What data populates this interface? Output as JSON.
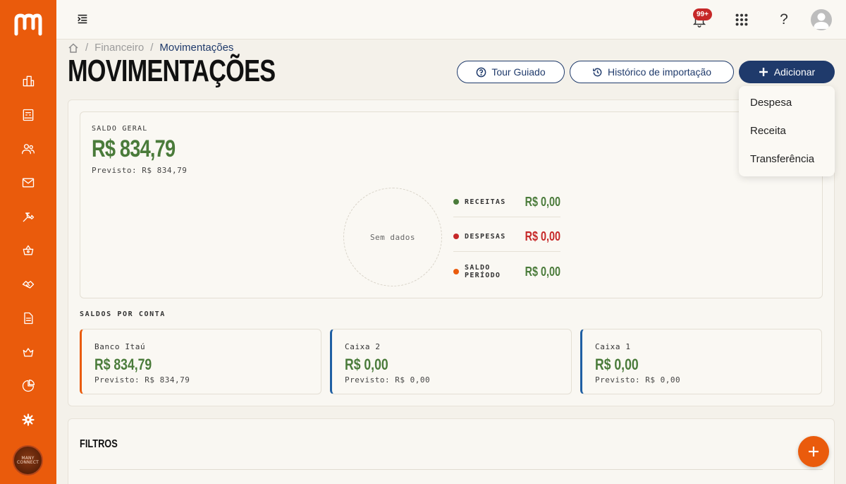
{
  "app": {
    "logo_icon": "m-logo-icon",
    "accent": "#ea5b0c",
    "primary": "#1f3a6b"
  },
  "sidebar": {
    "items": [
      {
        "icon": "building-icon"
      },
      {
        "icon": "cash-register-icon"
      },
      {
        "icon": "users-icon"
      },
      {
        "icon": "mail-icon"
      },
      {
        "icon": "tools-icon"
      },
      {
        "icon": "basket-icon"
      },
      {
        "icon": "handshake-icon"
      },
      {
        "icon": "document-icon"
      },
      {
        "icon": "crown-basket-icon"
      },
      {
        "icon": "pie-chart-icon"
      },
      {
        "icon": "gear-icon"
      }
    ],
    "org_avatar_text": "MANY CONNECT"
  },
  "topbar": {
    "notifications_badge": "99+",
    "help_label": "?"
  },
  "breadcrumb": {
    "items": [
      "Financeiro",
      "Movimentações"
    ]
  },
  "page": {
    "title": "MOVIMENTAÇÕES"
  },
  "actions": {
    "tour": "Tour Guiado",
    "history": "Histórico de importação",
    "add": "Adicionar"
  },
  "add_menu": {
    "options": [
      "Despesa",
      "Receita",
      "Transferência"
    ]
  },
  "summary": {
    "label": "SALDO GERAL",
    "value": "R$ 834,79",
    "previsto": "Previsto: R$ 834,79",
    "donut_empty": "Sem dados",
    "legend": [
      {
        "name": "RECEITAS",
        "value": "R$ 0,00",
        "color": "#4a7b3a"
      },
      {
        "name": "DESPESAS",
        "value": "R$ 0,00",
        "color": "#c62828"
      },
      {
        "name": "SALDO PERÍODO",
        "value": "R$ 0,00",
        "color": "#ea5b0c"
      }
    ]
  },
  "accounts": {
    "label": "SALDOS POR CONTA",
    "items": [
      {
        "name": "Banco Itaú",
        "value": "R$ 834,79",
        "previsto": "Previsto: R$ 834,79",
        "accent": "#ea5b0c"
      },
      {
        "name": "Caixa 2",
        "value": "R$ 0,00",
        "previsto": "Previsto: R$ 0,00",
        "accent": "#1f5fa3"
      },
      {
        "name": "Caixa 1",
        "value": "R$ 0,00",
        "previsto": "Previsto: R$ 0,00",
        "accent": "#1f5fa3"
      }
    ]
  },
  "filters": {
    "title": "FILTROS"
  }
}
